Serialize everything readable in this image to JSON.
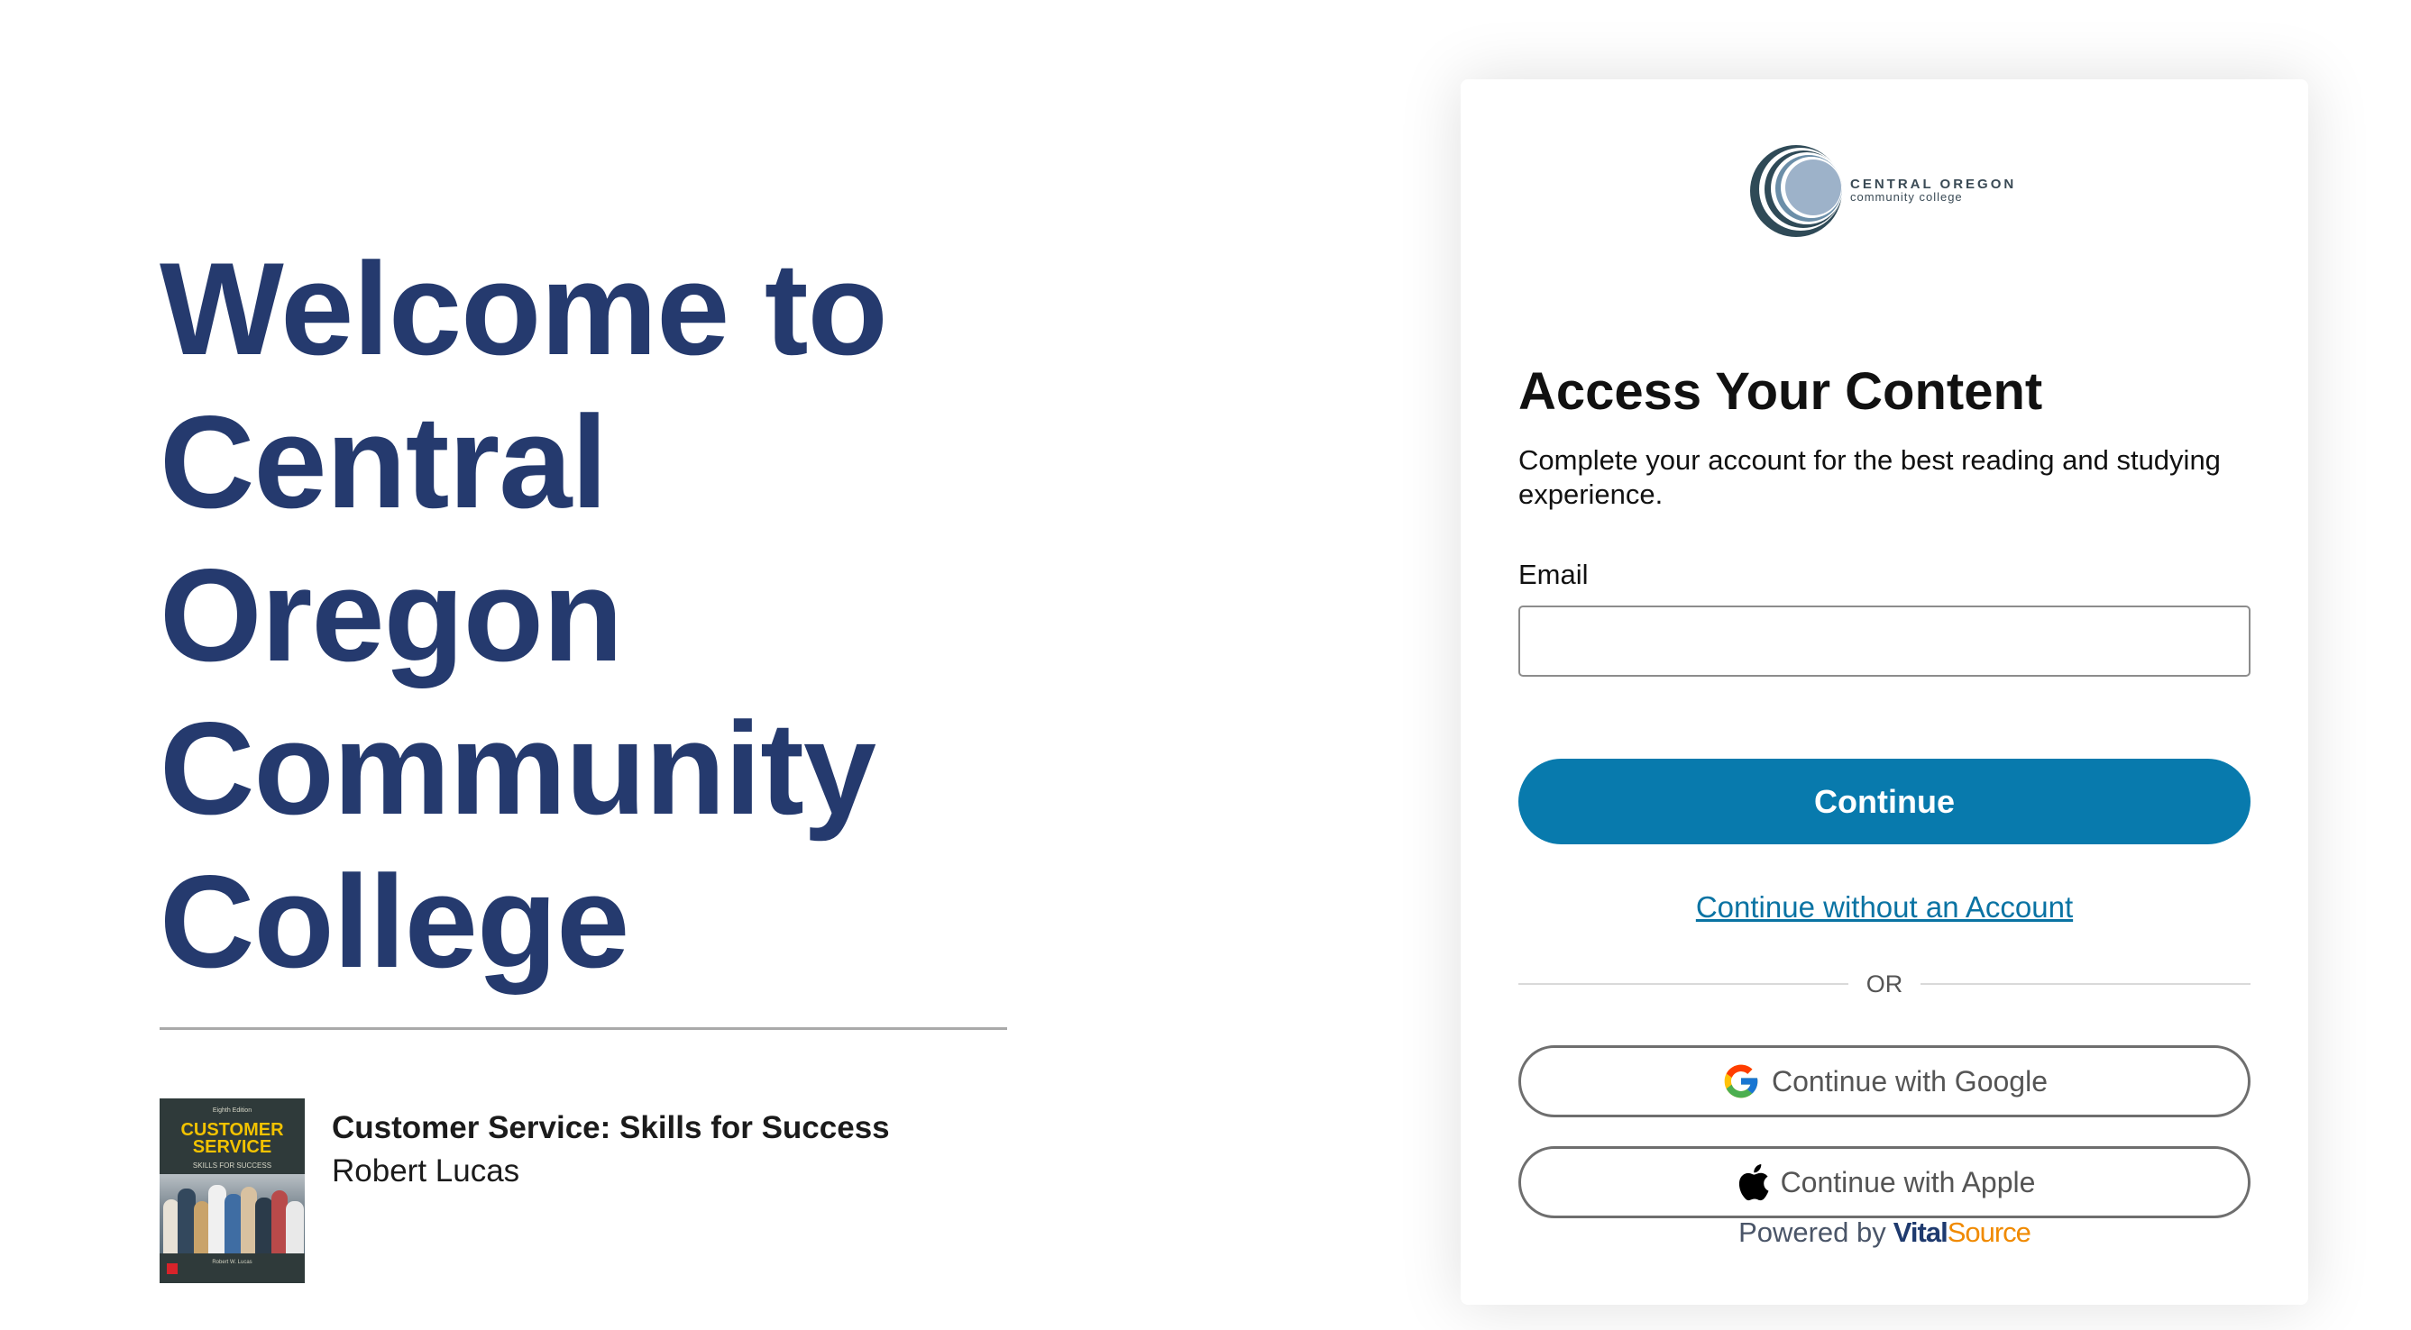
{
  "welcome": {
    "lines": [
      "Welcome to",
      "Central",
      "Oregon",
      "Community",
      "College"
    ]
  },
  "book": {
    "title": "Customer Service: Skills for Success",
    "author": "Robert Lucas",
    "cover": {
      "edition": "Eighth Edition",
      "title_line1": "CUSTOMER",
      "title_line2": "SERVICE",
      "subtitle": "SKILLS FOR SUCCESS",
      "author": "Robert W. Lucas"
    }
  },
  "card": {
    "logo": {
      "name": "CENTRAL OREGON",
      "sub": "community college"
    },
    "heading": "Access Your Content",
    "subtext": "Complete your account for the best reading and studying experience.",
    "email_label": "Email",
    "email_value": "",
    "email_placeholder": "",
    "continue_label": "Continue",
    "no_account_label": "Continue without an Account",
    "or_label": "OR",
    "google_label": "Continue with Google",
    "apple_label": "Continue with Apple",
    "powered_by": "Powered by",
    "brand_vital": "Vital",
    "brand_source": "Source"
  },
  "icons": {
    "google": "google-g-icon",
    "apple": "apple-logo-icon",
    "college_logo": "cocc-circle-logo"
  },
  "colors": {
    "welcome_text": "#253a6e",
    "primary_button": "#087aad",
    "link": "#0a73a3",
    "brand_orange": "#f08a00",
    "brand_navy": "#1f3a6e"
  }
}
